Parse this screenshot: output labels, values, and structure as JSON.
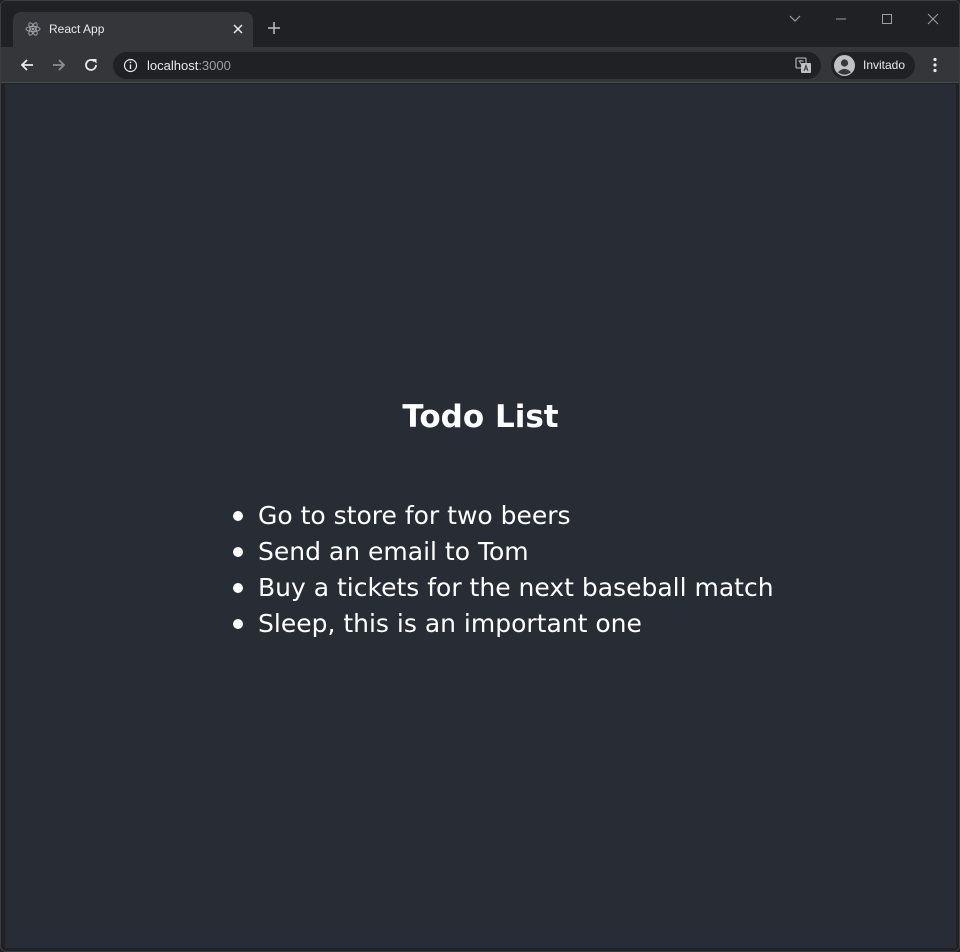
{
  "browser": {
    "tab": {
      "title": "React App",
      "favicon": "react-atom-icon"
    },
    "address_bar": {
      "host": "localhost",
      "port": ":3000",
      "info_icon": "info-icon",
      "translate_icon": "translate-icon"
    },
    "profile": {
      "label": "Invitado",
      "avatar_icon": "person-icon"
    },
    "nav_icons": [
      "back-arrow-icon",
      "forward-arrow-icon",
      "reload-icon",
      "kebab-menu-icon"
    ],
    "window_icons": [
      "tab-search-chevron-icon",
      "minimize-icon",
      "maximize-icon",
      "close-window-icon"
    ]
  },
  "page": {
    "title": "Todo List",
    "todos": [
      "Go to store for two beers",
      "Send an email to Tom",
      "Buy a tickets for the next baseball match",
      "Sleep, this is an important one"
    ]
  },
  "colors": {
    "page_background": "#282c34",
    "browser_frame": "#202124",
    "toolbar": "#35363a",
    "text": "#ffffff"
  }
}
